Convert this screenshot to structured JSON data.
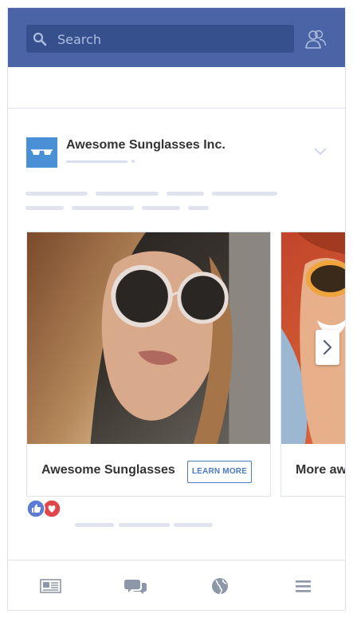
{
  "header": {
    "search_label": "Search"
  },
  "post": {
    "page_name": "Awesome Sunglasses Inc."
  },
  "carousel": {
    "cards": [
      {
        "title": "Awesome Sunglasses",
        "cta_label": "LEARN MORE"
      },
      {
        "title": "More awe"
      }
    ]
  },
  "icons": {
    "search": "search-icon",
    "friends": "friends-icon",
    "avatar": "sunglasses-icon",
    "menu": "chevron-down-icon",
    "next": "chevron-right-icon",
    "like": "like-icon",
    "love": "heart-icon",
    "feed": "news-feed-icon",
    "messages": "chat-icon",
    "globe": "globe-icon",
    "more": "hamburger-icon"
  },
  "colors": {
    "brand": "#4a64a6",
    "accent": "#4a7ac2",
    "like": "#5b7bd5",
    "love": "#e0474c"
  }
}
